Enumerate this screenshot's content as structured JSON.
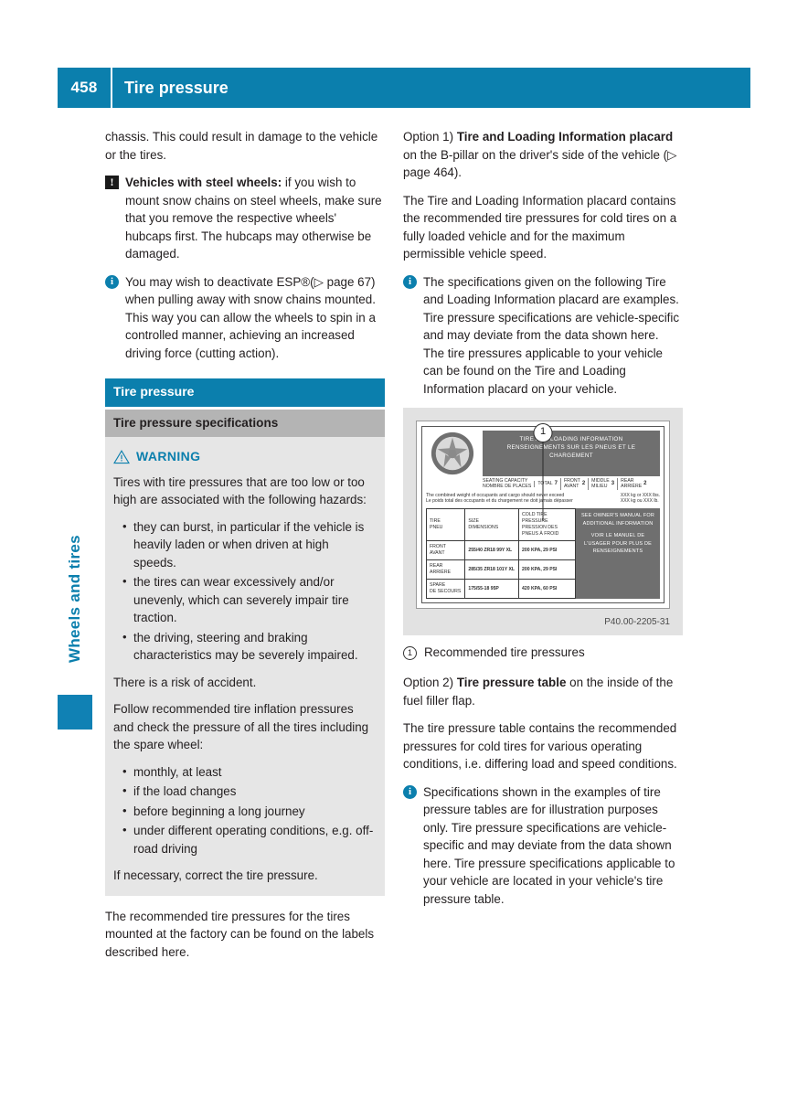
{
  "header": {
    "page_number": "458",
    "title": "Tire pressure",
    "accent_color": "#0b7fad"
  },
  "side_tab": {
    "label": "Wheels and tires"
  },
  "left_column": {
    "intro_paragraph": "chassis. This could result in damage to the vehicle or the tires.",
    "warning_note": {
      "icon": "exclamation-box-icon",
      "lead": "Vehicles with steel wheels:",
      "text": " if you wish to mount snow chains on steel wheels, make sure that you remove the respective wheels' hubcaps first. The hubcaps may otherwise be damaged."
    },
    "info_note": {
      "icon": "info-circle-icon",
      "text": "You may wish to deactivate ESP®(▷ page 67) when pulling away with snow chains mounted. This way you can allow the wheels to spin in a controlled manner, achieving an increased driving force (cutting action)."
    },
    "section_bar": "Tire pressure",
    "subsection_bar": "Tire pressure specifications",
    "warning_box": {
      "icon": "warning-triangle-icon",
      "label": "WARNING",
      "intro": "Tires with tire pressures that are too low or too high are associated with the following hazards:",
      "hazards": [
        "they can burst, in particular if the vehicle is heavily laden or when driven at high speeds.",
        "the tires can wear excessively and/or unevenly, which can severely impair tire traction.",
        "the driving, steering and braking characteristics may be severely impaired."
      ],
      "risk_line": "There is a risk of accident.",
      "follow_line": "Follow recommended tire inflation pressures and check the pressure of all the tires including the spare wheel:",
      "checks": [
        "monthly, at least",
        "if the load changes",
        "before beginning a long journey",
        "under different operating conditions, e.g. off-road driving"
      ],
      "closing": "If necessary, correct the tire pressure."
    },
    "closing_paragraph": "The recommended tire pressures for the tires mounted at the factory can be found on the labels described here."
  },
  "right_column": {
    "option1": {
      "prefix": "Option 1) ",
      "bold": "Tire and Loading Information placard",
      "suffix": " on the B-pillar on the driver's side of the vehicle (▷ page 464)."
    },
    "option1_body": "The Tire and Loading Information placard contains the recommended tire pressures for cold tires on a fully loaded vehicle and for the maximum permissible vehicle speed.",
    "info_note": {
      "icon": "info-circle-icon",
      "text": "The specifications given on the following Tire and Loading Information placard are examples. Tire pressure specifications are vehicle-specific and may deviate from the data shown here. The tire pressures applicable to your vehicle can be found on the Tire and Loading Information placard on your vehicle."
    },
    "figure": {
      "code": "P40.00-2205-31",
      "callout_number": "1",
      "caption_number": "1",
      "caption_text": "Recommended tire pressures",
      "placard": {
        "banner_line1": "TIRE AND LOADING INFORMATION",
        "banner_line2": "RENSEIGNEMENTS SUR LES PNEUS ET LE CHARGEMENT",
        "seating": {
          "label_en": "SEATING CAPACITY",
          "label_fr": "NOMBRE DE PLACES",
          "cells": [
            {
              "en": "TOTAL",
              "fr": "",
              "value": "7"
            },
            {
              "en": "FRONT",
              "fr": "AVANT",
              "value": "2"
            },
            {
              "en": "MIDDLE",
              "fr": "MILIEU",
              "value": "3"
            },
            {
              "en": "REAR",
              "fr": "ARRIÈRE",
              "value": "2"
            }
          ]
        },
        "weight_en": "The combined weight of occupants and cargo should never exceed",
        "weight_fr": "Le poids total des occupants et du chargement ne doit jamais dépasser",
        "weight_units": [
          {
            "value": "XXX",
            "unit": "kg or"
          },
          {
            "value": "XXX",
            "unit": "lbs."
          },
          {
            "value": "XXX",
            "unit": "kg ou"
          },
          {
            "value": "XXX",
            "unit": "lb."
          }
        ],
        "table_headers": {
          "tire_en": "TIRE",
          "tire_fr": "PNEU",
          "size_en": "SIZE",
          "size_fr": "DIMENSIONS",
          "press_1": "COLD TIRE PRESSURE",
          "press_2": "PRESSION DES",
          "press_3": "PNEUS À FROID"
        },
        "rows": [
          {
            "label_en": "FRONT",
            "label_fr": "AVANT",
            "size": "255/40 ZR18 99Y XL",
            "pressure": "200 KPA, 29 PSI"
          },
          {
            "label_en": "REAR",
            "label_fr": "ARRIÈRE",
            "size": "285/35 ZR18 101Y XL",
            "pressure": "200 KPA, 29 PSI"
          },
          {
            "label_en": "SPARE",
            "label_fr": "DE SECOURS",
            "size": "175/55-18 95P",
            "pressure": "420 KPA, 60 PSI"
          }
        ],
        "owner_note_en": "SEE OWNER'S MANUAL FOR ADDITIONAL INFORMATION",
        "owner_note_fr": "VOIR LE MANUEL DE L'USAGER POUR PLUS DE RENSEIGNEMENTS"
      }
    },
    "option2": {
      "prefix": "Option 2) ",
      "bold": "Tire pressure table",
      "suffix": " on the inside of the fuel filler flap."
    },
    "option2_body": "The tire pressure table contains the recommended pressures for cold tires for various operating conditions, i.e. differing load and speed conditions.",
    "info_note2": {
      "icon": "info-circle-icon",
      "text": "Specifications shown in the examples of tire pressure tables are for illustration purposes only. Tire pressure specifications are vehicle-specific and may deviate from the data shown here. Tire pressure specifications applicable to your vehicle are located in your vehicle's tire pressure table."
    }
  }
}
